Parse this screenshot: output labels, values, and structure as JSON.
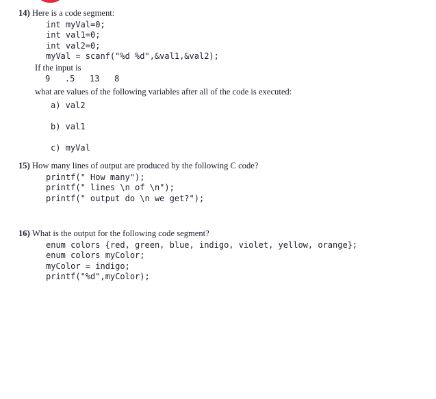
{
  "page": {
    "background_color": "#ffffff",
    "text_color": "#1c1c2b",
    "mark_color": "#e8263c",
    "mark_name": "red-ink-mark"
  },
  "questions": [
    {
      "number": "14)",
      "prompt": "Here is a code segment:",
      "code_lines": [
        "int myVal=0;",
        "int val1=0;",
        "int val2=0;",
        "myVal = scanf(\"%d %d\",&val1,&val2);"
      ],
      "input_label": "If the input is",
      "input_values": "9   .5   13   8",
      "follow_up": "what are values of the following variables after all of the code is executed:",
      "choices": [
        "a) val2",
        "b) val1",
        "c) myVal"
      ]
    },
    {
      "number": "15)",
      "prompt": "How many lines of output are produced by the following C code?",
      "code_lines": [
        "printf(\" How many\");",
        "printf(\" lines \\n of \\n\");",
        "printf(\" output do \\n we get?\");"
      ]
    },
    {
      "number": "16)",
      "prompt": "What is the output for the following code segment?",
      "code_lines": [
        "enum colors {red, green, blue, indigo, violet, yellow, orange};",
        "enum colors myColor;",
        "myColor = indigo;",
        "printf(\"%d\",myColor);"
      ]
    }
  ]
}
